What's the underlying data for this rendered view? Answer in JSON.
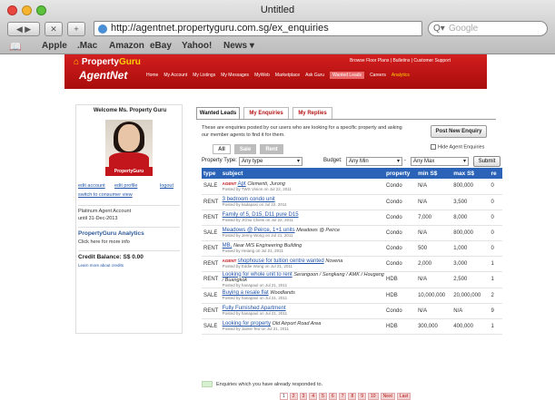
{
  "browser": {
    "title": "Untitled",
    "url": "http://agentnet.propertyguru.com.sg/ex_enquiries",
    "search_placeholder": "Google",
    "bookmarks": [
      "Apple",
      ".Mac",
      "Amazon",
      "eBay",
      "Yahoo!",
      "News ▾"
    ]
  },
  "site": {
    "logo_top": "Property",
    "logo_top_gold": "Guru",
    "logo_bottom": "AgentNet",
    "top_links": "Browse Floor Plans | Bulletins | Customer Support",
    "menu": [
      {
        "label": "Home"
      },
      {
        "label": "My Account"
      },
      {
        "label": "My Listings"
      },
      {
        "label": "My Messages"
      },
      {
        "label": "MyWeb"
      },
      {
        "label": "Marketplace"
      },
      {
        "label": "Ask Guru"
      },
      {
        "label": "Wanted Leads",
        "active": true
      },
      {
        "label": "Careers"
      },
      {
        "label": "Analytics",
        "gold": true
      }
    ]
  },
  "sidebar": {
    "welcome": "Welcome Ms. Property Guru",
    "badge": "PropertyGuru",
    "links": {
      "edit_account": "edit account",
      "edit_profile": "edit profile",
      "logout": "logout",
      "switch": "switch to consumer view"
    },
    "account_type": "Platinum Agent Account",
    "account_until": "until 31-Dec-2013",
    "analytics_title": "PropertyGuru Analytics",
    "analytics_text": "Click here for more info",
    "credit_title": "Credit Balance: S$ 0.00",
    "credit_text": "Learn more about credits"
  },
  "content": {
    "tabs": [
      "Wanted Leads",
      "My Enquiries",
      "My Replies"
    ],
    "intro": "These are enquiries posted by our users who are looking for a specific property and asking our member agents to find it for them.",
    "post_button": "Post New Enquiry",
    "subtabs": [
      "All",
      "Sale",
      "Rent"
    ],
    "hide_label": "Hide Agent Enquiries",
    "filters": {
      "property_type_label": "Property Type:",
      "property_type_value": "Any type",
      "budget_label": "Budget:",
      "min_value": "Any Min",
      "max_value": "Any Max",
      "submit": "Submit"
    },
    "columns": [
      "type",
      "subject",
      "property",
      "min S$",
      "max S$",
      "re"
    ],
    "rows": [
      {
        "type": "SALE",
        "agent": true,
        "subject": "Apt",
        "location": "Clementi, Jurong",
        "meta": "Posted by TWS Vision on Jul 22, 2011",
        "property": "Condo",
        "min": "N/A",
        "max": "800,000",
        "re": "0",
        "green": false
      },
      {
        "type": "RENT",
        "agent": false,
        "subject": "3 bedroom condo unit",
        "location": "",
        "meta": "Posted by kadapasi on Jul 22, 2011",
        "property": "Condo",
        "min": "N/A",
        "max": "3,500",
        "re": "0",
        "green": false
      },
      {
        "type": "RENT",
        "agent": false,
        "subject": "Family of 5, D15, D11 pure D15",
        "location": "",
        "meta": "Posted by JChiu Chiew on Jul 22, 2011",
        "property": "Condo",
        "min": "7,000",
        "max": "8,000",
        "re": "0",
        "green": false
      },
      {
        "type": "SALE",
        "agent": false,
        "subject": "Meadows @ Peirce, 1+1 units",
        "location": "Meadows @ Peirce",
        "meta": "Posted by Jenny Wong on Jul 21, 2011",
        "property": "Condo",
        "min": "N/A",
        "max": "800,000",
        "re": "0",
        "green": false
      },
      {
        "type": "RENT",
        "agent": false,
        "subject": "MB,",
        "location": "Near MIS Engineering Building",
        "meta": "Posted by Heiang on Jul 21, 2011",
        "property": "Condo",
        "min": "500",
        "max": "1,000",
        "re": "0",
        "green": false
      },
      {
        "type": "RENT",
        "agent": true,
        "subject": "shophouse for tuition centre wanted",
        "location": "Novena",
        "meta": "Posted by Eddie Wong on Jul 21, 2011",
        "property": "Condo",
        "min": "2,000",
        "max": "3,000",
        "re": "1",
        "green": false
      },
      {
        "type": "RENT",
        "agent": false,
        "subject": "Looking for whole unit to rent",
        "location": "Serangoon / Sengkang / AMK / Hougang / Buangkok",
        "meta": "Posted by hanapaul on Jul 21, 2011",
        "property": "HDB",
        "min": "N/A",
        "max": "2,500",
        "re": "1",
        "green": false
      },
      {
        "type": "SALE",
        "agent": false,
        "subject": "Buying a resale flat",
        "location": "Woodlands",
        "meta": "Posted by hanapaul on Jul 21, 2011",
        "property": "HDB",
        "min": "10,000,000",
        "max": "20,000,000",
        "re": "2",
        "green": false
      },
      {
        "type": "RENT",
        "agent": false,
        "subject": "Fully Furnished Apartment",
        "location": "",
        "meta": "Posted by hanapaul on Jul 21, 2011",
        "property": "Condo",
        "min": "N/A",
        "max": "N/A",
        "re": "9",
        "green": false
      },
      {
        "type": "SALE",
        "agent": false,
        "subject": "Looking for property",
        "location": "Old Airport Road Area",
        "meta": "Posted by Jaime Teo on Jul 21, 2011",
        "property": "HDB",
        "min": "300,000",
        "max": "400,000",
        "re": "1",
        "green": false
      }
    ],
    "legend": "Enquiries which you have already responded to.",
    "pages": [
      "1",
      "2",
      "3",
      "4",
      "5",
      "6",
      "7",
      "8",
      "9",
      "10",
      "Next",
      "Last"
    ]
  }
}
